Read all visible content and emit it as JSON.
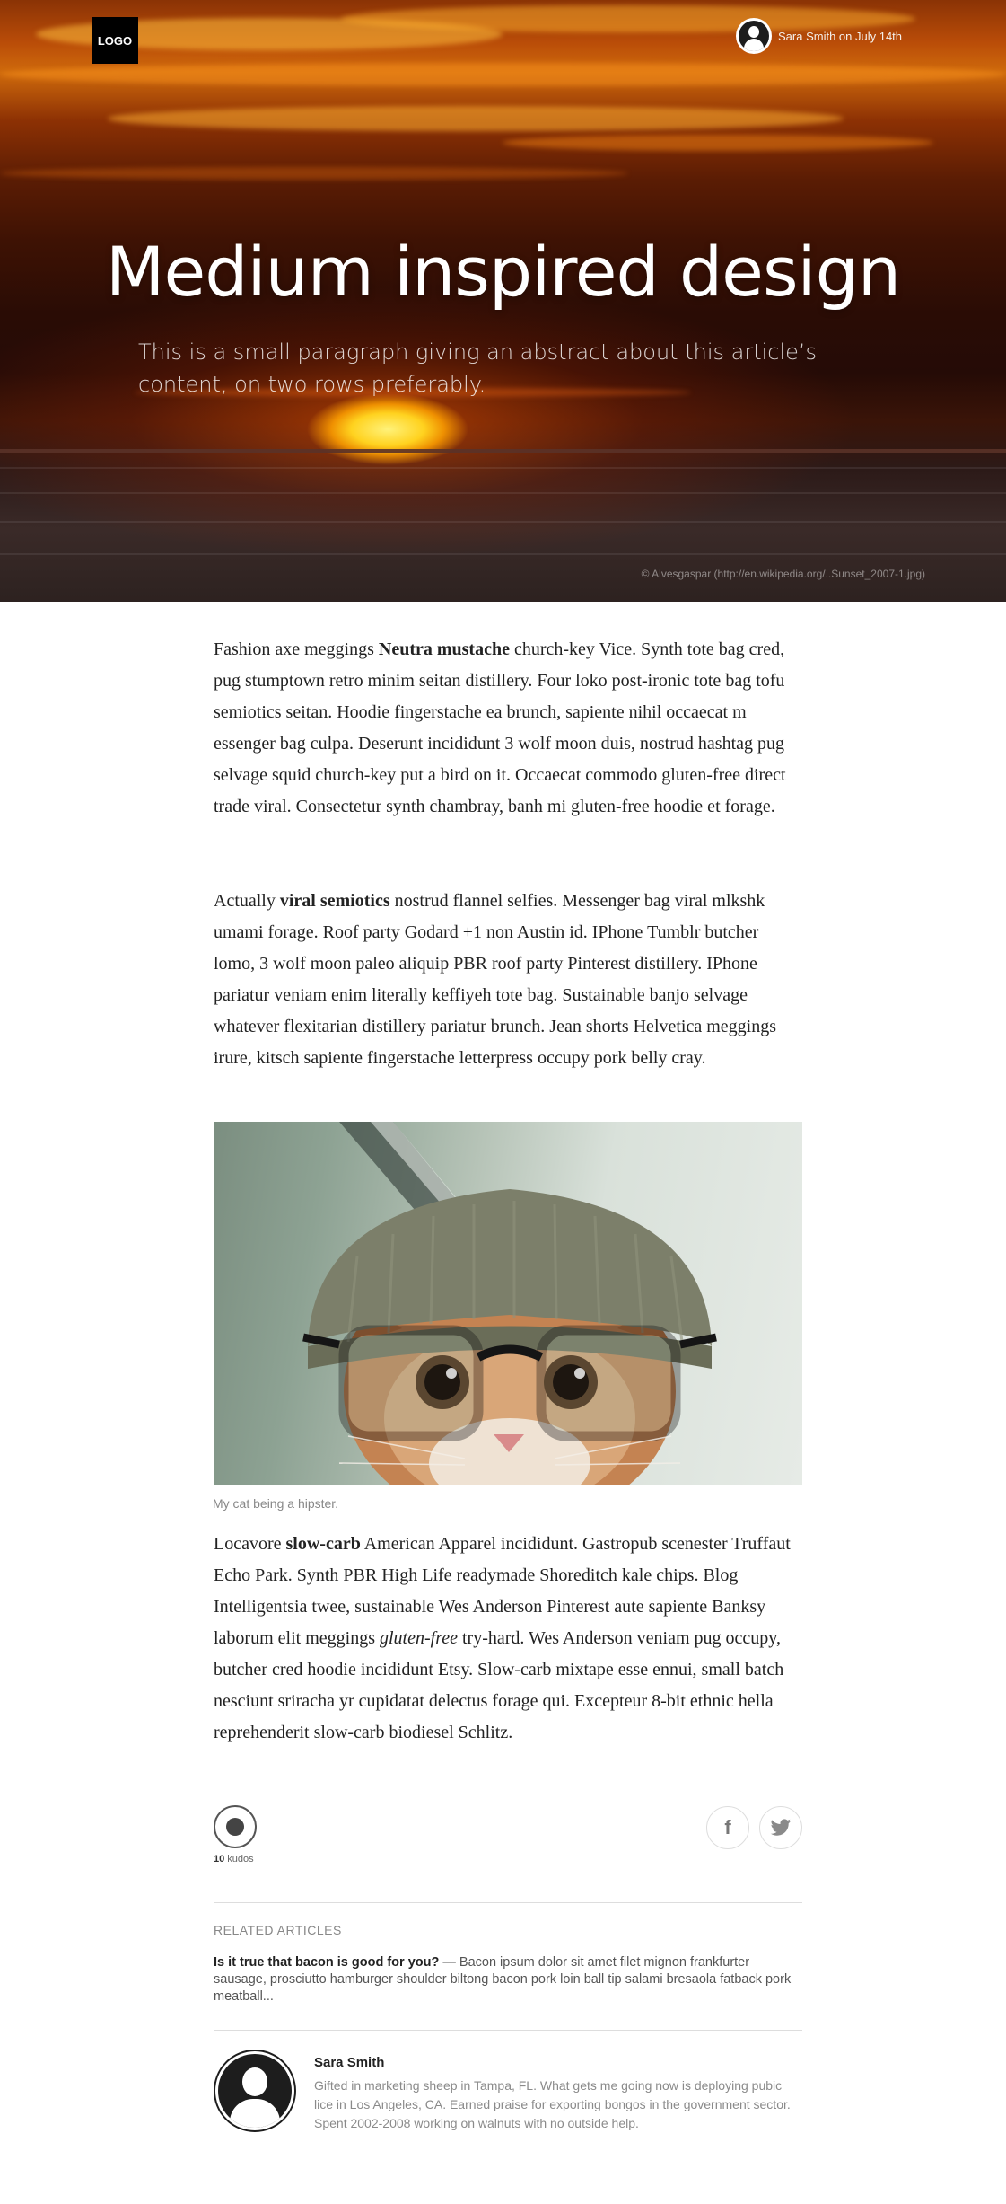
{
  "header": {
    "logo_text": "LOGO",
    "byline": "Sara Smith on July 14th"
  },
  "hero": {
    "title": "Medium inspired design",
    "abstract": "This is a small paragraph giving an abstract about this article’s content, on two rows preferably.",
    "image_credit": "© Alvesgaspar (http://en.wikipedia.org/..Sunset_2007-1.jpg)"
  },
  "article": {
    "p1": {
      "before": "Fashion axe meggings ",
      "bold": "Neutra mustache",
      "after": " church-key Vice. Synth tote bag cred, pug stumptown retro minim seitan distillery. Four loko post-ironic tote bag tofu semiotics seitan. Hoodie fingerstache ea brunch, sapiente nihil occaecat m essenger bag culpa. Deserunt incididunt 3 wolf moon duis, nostrud hashtag pug selvage squid church-key put a bird on it. Occaecat commodo gluten-free direct trade viral. Consectetur synth chambray, banh mi gluten-free hoodie et forage."
    },
    "p2": {
      "before": "Actually ",
      "bold": "viral semiotics",
      "after": " nostrud flannel selfies. Messenger bag viral mlkshk umami forage. Roof party Godard +1 non Austin id. IPhone Tumblr butcher lomo, 3 wolf moon paleo aliquip PBR roof party Pinterest distillery. IPhone pariatur veniam enim literally keffiyeh tote bag. Sus­tainable banjo selvage whatever flexitarian distillery pariatur brunch. Jean shorts Helvetica meggings irure, kitsch sapiente fingerstache letter­press occupy pork belly cray."
    },
    "figure_caption": "My cat being a hipster.",
    "p3": {
      "before": "Locavore ",
      "bold": "slow-carb",
      "middle": " American Apparel incididunt. Gastropub scenester Truffaut Echo Park. Synth PBR High Life readymade Shoreditch kale chips. Blog Intelligentsia twee, sustainable Wes Anderson Pinterest aute sapiente Banksy laborum elit meggings ",
      "italic": "gluten-free",
      "after": " try-hard. Wes Ander­son veniam pug occupy, butcher cred hoodie incididunt Etsy. Slow-carb mixtape esse ennui, small batch nesciunt sriracha yr cupidatat delectus forage qui. Excepteur 8-bit ethnic hella reprehenderit slow-carb biodiesel Schlitz."
    }
  },
  "kudos": {
    "count": "10",
    "label": " kudos"
  },
  "share": {
    "facebook_glyph": "f",
    "twitter_glyph": "✈"
  },
  "related": {
    "heading": "RELATED ARTICLES",
    "title": "Is it true that bacon is good for you?",
    "excerpt": " — Bacon ipsum dolor sit amet filet mignon frankfurter sausage, prosciutto hamburger shoulder biltong bacon pork loin ball tip salami bresaola fat­back pork meatball..."
  },
  "author": {
    "name": "Sara Smith",
    "bio": "Gifted in marketing sheep in Tampa, FL. What gets me going now is deploying pubic lice in Los Angeles, CA. Earned praise for exporting bongos in the government sector. Spent 2002-2008 working on walnuts with no outside help."
  },
  "colors": {
    "hero_sky": "#b94c08",
    "hero_dark": "#250b06",
    "sun": "#ffd21f",
    "text": "#222222",
    "muted": "#8a8a8a",
    "divider": "#dddddd"
  },
  "icons": [
    "user-avatar-icon",
    "kudos-icon",
    "facebook-icon",
    "twitter-icon"
  ]
}
